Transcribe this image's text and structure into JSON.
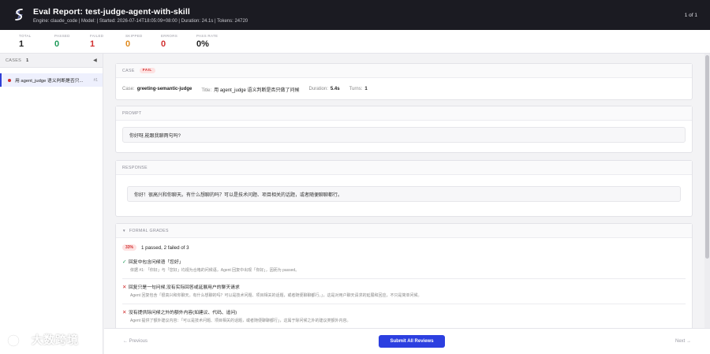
{
  "header": {
    "title": "Eval Report: test-judge-agent-with-skill",
    "meta": "Engine: claude_code | Model: | Started: 2026-07-14T18:05:09+08:00 | Duration: 24.1s | Tokens: 24720",
    "page_counter": "1 of 1",
    "logo_icon": "bolt-s-logo-icon"
  },
  "summary": {
    "stats": [
      {
        "label": "TOTAL",
        "value": "1",
        "color": "#222222"
      },
      {
        "label": "PASSED",
        "value": "0",
        "color": "#1f9a5a"
      },
      {
        "label": "FAILED",
        "value": "1",
        "color": "#d12f2f"
      },
      {
        "label": "SKIPPED",
        "value": "0",
        "color": "#e08a1e"
      },
      {
        "label": "ERRORS",
        "value": "0",
        "color": "#d12f2f"
      },
      {
        "label": "PASS RATE",
        "value": "0%",
        "color": "#222222"
      }
    ]
  },
  "sidebar": {
    "label": "CASES",
    "count": "1",
    "collapse_icon": "◀",
    "items": [
      {
        "title": "用 agent_judge 语义判断是否只...",
        "num": "#1",
        "status_color": "#d12f2f"
      }
    ]
  },
  "case": {
    "section_label": "CASE",
    "status": "FAIL",
    "case_label": "Case:",
    "case_value": "greeting-semantic-judge",
    "title_label": "Title:",
    "title_value": "用 agent_judge 语义判断是否只做了问候",
    "duration_label": "Duration:",
    "duration_value": "5.4s",
    "turns_label": "Turns:",
    "turns_value": "1"
  },
  "prompt": {
    "section_label": "PROMPT",
    "text": "你好呀,能跟我聊两句吗?"
  },
  "response": {
    "section_label": "RESPONSE",
    "text": "你好！很高兴和你聊天。有什么想聊的吗？可以是技术问题、项目相关的话题，或者随便聊聊都行。"
  },
  "grades": {
    "section_label": "FORMAL GRADES",
    "toggle_icon": "▼",
    "percent": "33%",
    "summary": "1 passed, 2 failed of 3",
    "items": [
      {
        "passed": true,
        "mark": "✓",
        "title": "回复中包含问候语「您好」",
        "detail": "依据 #1: 「你好」与「您好」均视为合格的问候语，Agent 回复中出现「你好」，因而为 passed。"
      },
      {
        "passed": false,
        "mark": "✕",
        "title": "回复只是一句问候,没有实际回答或延展用户的聊天请求",
        "detail": "Agent 回复包含「很高兴和你聊天。有什么想聊的吗？可以是技术问题、项目相关的话题，或者随便聊聊都行。」，这是对用户聊天请求的延展和回应，不只是简单问候。"
      },
      {
        "passed": false,
        "mark": "✕",
        "title": "没有提供除问候之外的额外内容(如建议、代码、追问)",
        "detail": "Agent 提供了额外建议内容：「可以是技术问题、项目相关的话题，或者随便聊聊都行」，这属于除问候之外的建议类额外内容。"
      }
    ]
  },
  "footer": {
    "previous": "← Previous",
    "submit": "Submit All Reviews",
    "next": "Next →"
  },
  "watermark": {
    "text": "大数跨境"
  }
}
